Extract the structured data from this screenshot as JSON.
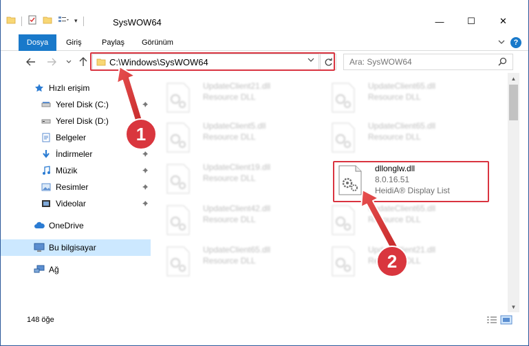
{
  "window": {
    "title": "SysWOW64",
    "controls": {
      "minimize": "—",
      "maximize": "☐",
      "close": "✕"
    }
  },
  "ribbon": {
    "tabs": [
      "Dosya",
      "Giriş",
      "Paylaş",
      "Görünüm"
    ],
    "help": "?"
  },
  "navigation": {
    "address": "C:\\Windows\\SysWOW64",
    "search_placeholder": "Ara: SysWOW64"
  },
  "sidebar": {
    "items": [
      {
        "label": "Hızlı erişim",
        "icon": "star-icon",
        "pinned": false
      },
      {
        "label": "Yerel Disk (C:)",
        "icon": "drive-icon",
        "pinned": true
      },
      {
        "label": "Yerel Disk (D:)",
        "icon": "drive-icon",
        "pinned": false
      },
      {
        "label": "Belgeler",
        "icon": "documents-icon",
        "pinned": true
      },
      {
        "label": "İndirmeler",
        "icon": "download-icon",
        "pinned": true
      },
      {
        "label": "Müzik",
        "icon": "music-icon",
        "pinned": true
      },
      {
        "label": "Resimler",
        "icon": "pictures-icon",
        "pinned": true
      },
      {
        "label": "Videolar",
        "icon": "videos-icon",
        "pinned": true
      },
      {
        "label": "OneDrive",
        "icon": "cloud-icon",
        "pinned": false
      },
      {
        "label": "Bu bilgisayar",
        "icon": "computer-icon",
        "pinned": false,
        "selected": true
      },
      {
        "label": "Ağ",
        "icon": "network-icon",
        "pinned": false
      }
    ]
  },
  "files": {
    "items": [
      {
        "name": "UpdateClient21.dll",
        "type": "Resource DLL"
      },
      {
        "name": "UpdateClient65.dll",
        "type": "Resource DLL"
      },
      {
        "name": "UpdateClient5.dll",
        "type": "Resource DLL"
      },
      {
        "name": "UpdateClient65.dll",
        "type": "Resource DLL"
      },
      {
        "name": "UpdateClient19.dll",
        "type": "Resource DLL"
      },
      {
        "name": "UpdateClient42.dll",
        "type": "Resource DLL"
      },
      {
        "name": "UpdateClient65.dll",
        "type": "Resource DLL"
      },
      {
        "name": "UpdateClient65.dll",
        "type": "Resource DLL"
      },
      {
        "name": "UpdateClient21.dll",
        "type": "Resource DLL"
      }
    ],
    "highlighted": {
      "name": "dllonglw.dll",
      "version": "8.0.16.51",
      "description": "HeidiA® Display List"
    }
  },
  "status": {
    "count": "148 öğe"
  },
  "annotations": {
    "step1": "1",
    "step2": "2",
    "color": "#e03c3c"
  }
}
